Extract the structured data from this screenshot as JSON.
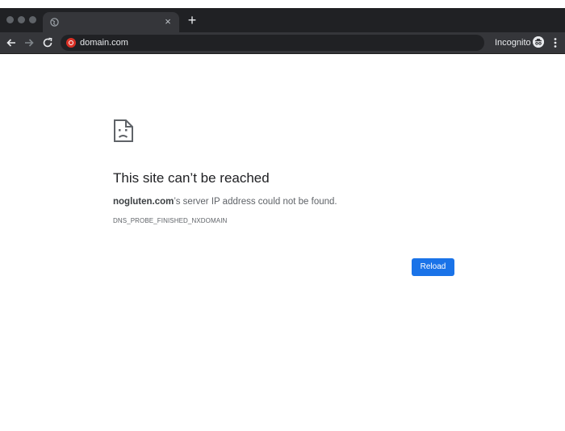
{
  "window": {
    "tab": {
      "title": "",
      "favicon": "globe-icon"
    },
    "new_tab": "+",
    "close_tab": "×"
  },
  "toolbar": {
    "url": "domain.com",
    "incognito_label": "Incognito"
  },
  "error": {
    "icon": "sad-page-icon",
    "title": "This site can’t be reached",
    "host": "nogluten.com",
    "message_suffix": "’s server IP address could not be found.",
    "code": "DNS_PROBE_FINISHED_NXDOMAIN",
    "reload_label": "Reload"
  },
  "colors": {
    "chrome_dark": "#202124",
    "toolbar": "#35363a",
    "accent_blue": "#1a73e8",
    "text_primary": "#202124",
    "text_secondary": "#5f6368"
  }
}
